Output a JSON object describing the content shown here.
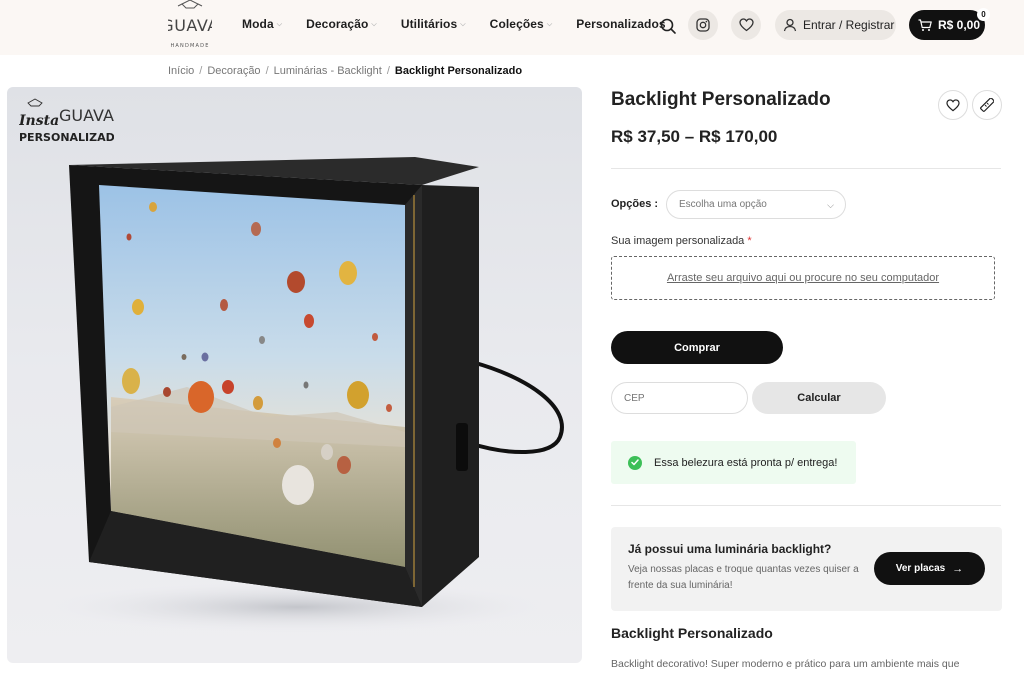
{
  "header": {
    "logo_text": "GUAVA",
    "logo_subtext": "HANDMADE",
    "nav": [
      {
        "label": "Moda",
        "has_dropdown": true
      },
      {
        "label": "Decoração",
        "has_dropdown": true
      },
      {
        "label": "Utilitários",
        "has_dropdown": true
      },
      {
        "label": "Coleções",
        "has_dropdown": true
      },
      {
        "label": "Personalizados",
        "has_dropdown": false
      }
    ],
    "login_label": "Entrar / Registrar",
    "cart_total": "R$ 0,00",
    "cart_count": "0"
  },
  "breadcrumb": {
    "items": [
      "Início",
      "Decoração",
      "Luminárias - Backlight"
    ],
    "separator": "/",
    "current": "Backlight Personalizado"
  },
  "image": {
    "watermark_insta": "Insta",
    "watermark_brand": "GUAVA",
    "watermark_sub": "PERSONALIZADOS"
  },
  "product": {
    "title": "Backlight Personalizado",
    "price": "R$ 37,50 – R$ 170,00",
    "options_label": "Opções",
    "options_placeholder": "Escolha uma opção",
    "upload_label": "Sua imagem personalizada",
    "upload_required": "*",
    "upload_hint": "Arraste seu arquivo aqui ou procure no seu computador",
    "buy_label": "Comprar",
    "cep_placeholder": "CEP",
    "calc_label": "Calcular",
    "stock_text": "Essa belezura está pronta p/ entrega!"
  },
  "promo": {
    "title": "Já possui uma luminária backlight?",
    "text": "Veja nossas placas e troque quantas vezes quiser a frente da sua luminária!",
    "button_label": "Ver placas"
  },
  "description": {
    "title": "Backlight Personalizado",
    "text": "Backlight decorativo! Super moderno e prático para um ambiente mais que"
  },
  "colors": {
    "header_bg": "#fbf7f4",
    "accent_dark": "#111111",
    "success": "#3dbf58"
  },
  "icons": [
    "search-icon",
    "instagram-icon",
    "heart-icon",
    "user-icon",
    "cart-icon",
    "check-icon",
    "ruler-icon",
    "arrow-right-icon"
  ]
}
